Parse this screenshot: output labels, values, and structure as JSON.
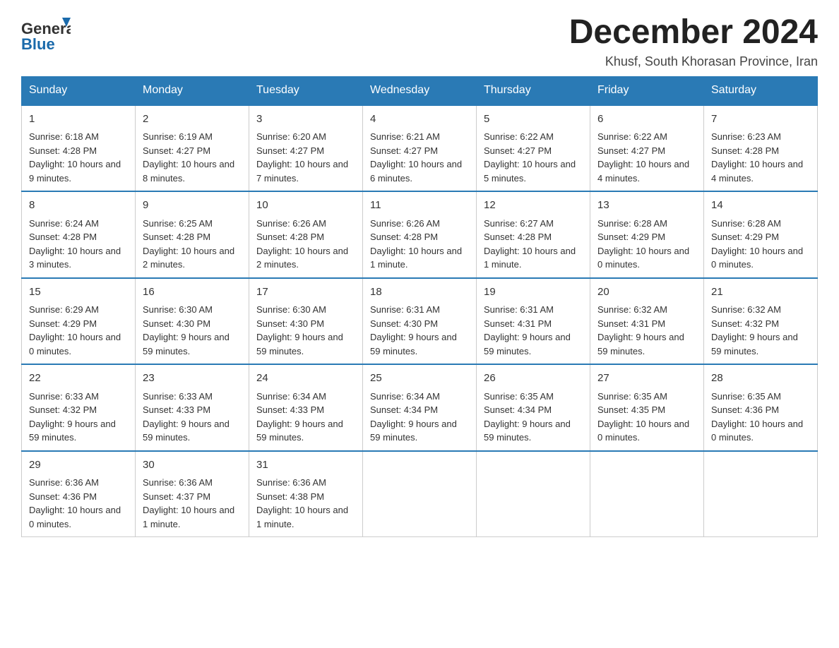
{
  "header": {
    "logo": {
      "text_general": "General",
      "text_blue": "Blue"
    },
    "title": "December 2024",
    "location": "Khusf, South Khorasan Province, Iran"
  },
  "calendar": {
    "days_of_week": [
      "Sunday",
      "Monday",
      "Tuesday",
      "Wednesday",
      "Thursday",
      "Friday",
      "Saturday"
    ],
    "weeks": [
      [
        {
          "day": "1",
          "sunrise": "6:18 AM",
          "sunset": "4:28 PM",
          "daylight": "10 hours and 9 minutes."
        },
        {
          "day": "2",
          "sunrise": "6:19 AM",
          "sunset": "4:27 PM",
          "daylight": "10 hours and 8 minutes."
        },
        {
          "day": "3",
          "sunrise": "6:20 AM",
          "sunset": "4:27 PM",
          "daylight": "10 hours and 7 minutes."
        },
        {
          "day": "4",
          "sunrise": "6:21 AM",
          "sunset": "4:27 PM",
          "daylight": "10 hours and 6 minutes."
        },
        {
          "day": "5",
          "sunrise": "6:22 AM",
          "sunset": "4:27 PM",
          "daylight": "10 hours and 5 minutes."
        },
        {
          "day": "6",
          "sunrise": "6:22 AM",
          "sunset": "4:27 PM",
          "daylight": "10 hours and 4 minutes."
        },
        {
          "day": "7",
          "sunrise": "6:23 AM",
          "sunset": "4:28 PM",
          "daylight": "10 hours and 4 minutes."
        }
      ],
      [
        {
          "day": "8",
          "sunrise": "6:24 AM",
          "sunset": "4:28 PM",
          "daylight": "10 hours and 3 minutes."
        },
        {
          "day": "9",
          "sunrise": "6:25 AM",
          "sunset": "4:28 PM",
          "daylight": "10 hours and 2 minutes."
        },
        {
          "day": "10",
          "sunrise": "6:26 AM",
          "sunset": "4:28 PM",
          "daylight": "10 hours and 2 minutes."
        },
        {
          "day": "11",
          "sunrise": "6:26 AM",
          "sunset": "4:28 PM",
          "daylight": "10 hours and 1 minute."
        },
        {
          "day": "12",
          "sunrise": "6:27 AM",
          "sunset": "4:28 PM",
          "daylight": "10 hours and 1 minute."
        },
        {
          "day": "13",
          "sunrise": "6:28 AM",
          "sunset": "4:29 PM",
          "daylight": "10 hours and 0 minutes."
        },
        {
          "day": "14",
          "sunrise": "6:28 AM",
          "sunset": "4:29 PM",
          "daylight": "10 hours and 0 minutes."
        }
      ],
      [
        {
          "day": "15",
          "sunrise": "6:29 AM",
          "sunset": "4:29 PM",
          "daylight": "10 hours and 0 minutes."
        },
        {
          "day": "16",
          "sunrise": "6:30 AM",
          "sunset": "4:30 PM",
          "daylight": "9 hours and 59 minutes."
        },
        {
          "day": "17",
          "sunrise": "6:30 AM",
          "sunset": "4:30 PM",
          "daylight": "9 hours and 59 minutes."
        },
        {
          "day": "18",
          "sunrise": "6:31 AM",
          "sunset": "4:30 PM",
          "daylight": "9 hours and 59 minutes."
        },
        {
          "day": "19",
          "sunrise": "6:31 AM",
          "sunset": "4:31 PM",
          "daylight": "9 hours and 59 minutes."
        },
        {
          "day": "20",
          "sunrise": "6:32 AM",
          "sunset": "4:31 PM",
          "daylight": "9 hours and 59 minutes."
        },
        {
          "day": "21",
          "sunrise": "6:32 AM",
          "sunset": "4:32 PM",
          "daylight": "9 hours and 59 minutes."
        }
      ],
      [
        {
          "day": "22",
          "sunrise": "6:33 AM",
          "sunset": "4:32 PM",
          "daylight": "9 hours and 59 minutes."
        },
        {
          "day": "23",
          "sunrise": "6:33 AM",
          "sunset": "4:33 PM",
          "daylight": "9 hours and 59 minutes."
        },
        {
          "day": "24",
          "sunrise": "6:34 AM",
          "sunset": "4:33 PM",
          "daylight": "9 hours and 59 minutes."
        },
        {
          "day": "25",
          "sunrise": "6:34 AM",
          "sunset": "4:34 PM",
          "daylight": "9 hours and 59 minutes."
        },
        {
          "day": "26",
          "sunrise": "6:35 AM",
          "sunset": "4:34 PM",
          "daylight": "9 hours and 59 minutes."
        },
        {
          "day": "27",
          "sunrise": "6:35 AM",
          "sunset": "4:35 PM",
          "daylight": "10 hours and 0 minutes."
        },
        {
          "day": "28",
          "sunrise": "6:35 AM",
          "sunset": "4:36 PM",
          "daylight": "10 hours and 0 minutes."
        }
      ],
      [
        {
          "day": "29",
          "sunrise": "6:36 AM",
          "sunset": "4:36 PM",
          "daylight": "10 hours and 0 minutes."
        },
        {
          "day": "30",
          "sunrise": "6:36 AM",
          "sunset": "4:37 PM",
          "daylight": "10 hours and 1 minute."
        },
        {
          "day": "31",
          "sunrise": "6:36 AM",
          "sunset": "4:38 PM",
          "daylight": "10 hours and 1 minute."
        },
        null,
        null,
        null,
        null
      ]
    ]
  }
}
